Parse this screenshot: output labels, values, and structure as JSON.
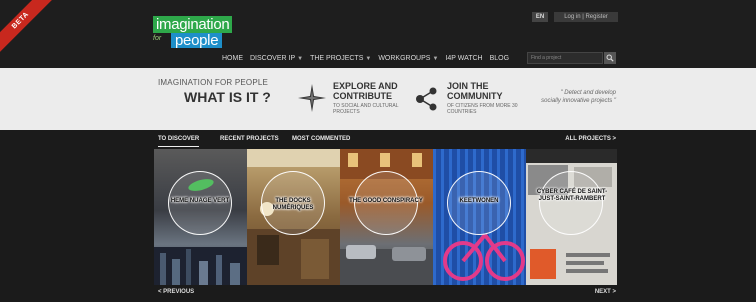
{
  "header": {
    "beta": "BETA",
    "logo": {
      "line1": "imagination",
      "line2": "for",
      "line3": "people"
    },
    "lang": "EN",
    "login": "Log in | Register",
    "nav": [
      {
        "label": "HOME",
        "caret": false
      },
      {
        "label": "DISCOVER IP",
        "caret": true
      },
      {
        "label": "THE PROJECTS",
        "caret": true
      },
      {
        "label": "WORKGROUPS",
        "caret": true
      },
      {
        "label": "I4P WATCH",
        "caret": false
      },
      {
        "label": "BLOG",
        "caret": false
      }
    ],
    "search_placeholder": "Find a project"
  },
  "intro": {
    "what_small": "IMAGINATION FOR PEOPLE",
    "what_big": "WHAT IS IT ?",
    "explore_title": "EXPLORE AND CONTRIBUTE",
    "explore_sub": "TO SOCIAL AND CULTURAL PROJECTS",
    "join_title": "JOIN THE COMMUNITY",
    "join_sub": "OF CITIZENS FROM MORE 30 COUNTRIES",
    "tagline": "\" Detect and develop socially innovative projects \""
  },
  "tabs": {
    "items": [
      "TO DISCOVER",
      "RECENT PROJECTS",
      "MOST COMMENTED"
    ],
    "active_index": 0,
    "all_projects": "ALL PROJECTS >"
  },
  "projects": [
    {
      "caption": "Heme nuage vert"
    },
    {
      "caption": "The Docks numériques"
    },
    {
      "caption": "The good conspiracy"
    },
    {
      "caption": "Keetwonen"
    },
    {
      "caption": "Cyber café de Saint-Just-Saint-Rambert"
    }
  ],
  "pager": {
    "prev": "< PREVIOUS",
    "next": "NEXT >"
  },
  "colors": {
    "logo_green": "#2ea84a",
    "logo_blue": "#1e8fc9",
    "beta_red": "#c8281e"
  }
}
